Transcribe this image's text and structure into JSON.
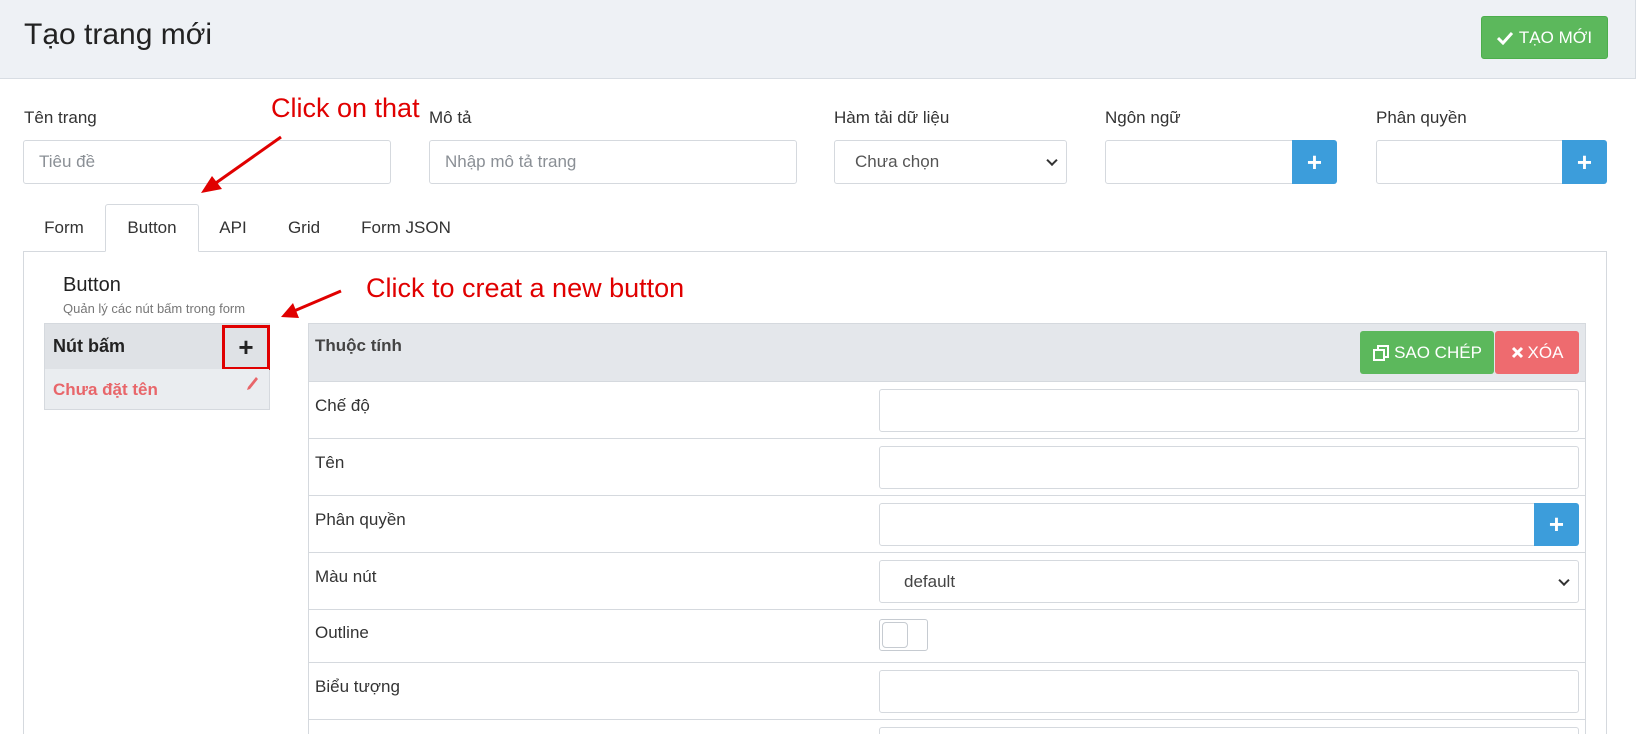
{
  "header": {
    "title": "Tạo trang mới",
    "create_label": "TẠO MỚI"
  },
  "fields": {
    "page_name": {
      "label": "Tên trang",
      "placeholder": "Tiêu đề"
    },
    "description": {
      "label": "Mô tả",
      "placeholder": "Nhập mô tả trang"
    },
    "data_loader": {
      "label": "Hàm tải dữ liệu",
      "selected": "Chưa chọn"
    },
    "language": {
      "label": "Ngôn ngữ"
    },
    "permission": {
      "label": "Phân quyền"
    }
  },
  "tabs": [
    {
      "label": "Form"
    },
    {
      "label": "Button",
      "active": true
    },
    {
      "label": "API"
    },
    {
      "label": "Grid"
    },
    {
      "label": "Form JSON"
    }
  ],
  "button_section": {
    "title": "Button",
    "subtitle": "Quản lý các nút bấm trong form",
    "list_header": "Nút bấm",
    "items": [
      {
        "label": "Chưa đặt tên"
      }
    ]
  },
  "properties": {
    "header": "Thuộc tính",
    "copy_label": "SAO CHÉP",
    "delete_label": "XÓA",
    "rows": [
      {
        "label": "Chế độ"
      },
      {
        "label": "Tên"
      },
      {
        "label": "Phân quyền"
      },
      {
        "label": "Màu nút",
        "value": "default"
      },
      {
        "label": "Outline"
      },
      {
        "label": "Biểu tượng"
      }
    ]
  },
  "annotations": {
    "click_on_that": "Click on that",
    "click_new_button": "Click to creat a new button"
  },
  "colors": {
    "success": "#5cb85c",
    "info": "#3c9ddb",
    "danger": "#ee6b6f",
    "annotation": "#e00000"
  }
}
